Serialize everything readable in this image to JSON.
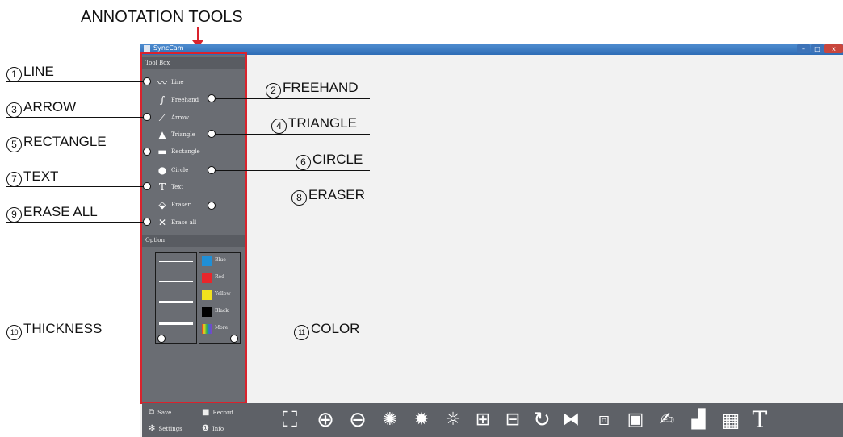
{
  "heading": "ANNOTATION TOOLS",
  "window": {
    "title": "SyncCam",
    "min": "–",
    "max": "□",
    "close": "x"
  },
  "toolbox": {
    "header": "Tool Box",
    "tools": {
      "line": "Line",
      "freehand": "Freehand",
      "arrow": "Arrow",
      "triangle": "Triangle",
      "rectangle": "Rectangle",
      "circle": "Circle",
      "text": "Text",
      "eraser": "Eraser",
      "erase_all": "Erase all"
    }
  },
  "option": {
    "header": "Option",
    "colors": [
      {
        "name": "Blue",
        "hex": "#1f8fd6"
      },
      {
        "name": "Red",
        "hex": "#e8262b"
      },
      {
        "name": "Yellow",
        "hex": "#f2e21e"
      },
      {
        "name": "Black",
        "hex": "#000000"
      },
      {
        "name": "More",
        "hex": "#3a6fd0"
      }
    ]
  },
  "bottom": {
    "save": "Save",
    "record": "Record",
    "settings": "Settings",
    "info": "Info"
  },
  "annotations": {
    "n1": "1",
    "l1": "LINE",
    "n2": "2",
    "l2": "FREEHAND",
    "n3": "3",
    "l3": "ARROW",
    "n4": "4",
    "l4": "TRIANGLE",
    "n5": "5",
    "l5": "RECTANGLE",
    "n6": "6",
    "l6": "CIRCLE",
    "n7": "7",
    "l7": "TEXT",
    "n8": "8",
    "l8": "ERASER",
    "n9": "9",
    "l9": "ERASE ALL",
    "n10": "10",
    "l10": "THICKNESS",
    "n11": "11",
    "l11": "COLOR"
  },
  "bottom_icons": [
    "user-frame-icon",
    "zoom-in-icon",
    "zoom-out-icon",
    "bulb-icon",
    "brightness-up-icon",
    "brightness-down-icon",
    "expand-icon",
    "shrink-icon",
    "rotate-icon",
    "flip-icon",
    "snapshot-icon",
    "image-compare-icon",
    "signature-icon",
    "bar-chart-icon",
    "grid-icon",
    "text-icon"
  ],
  "colors": {
    "highlight": "#d9232d",
    "panel": "#6a6d73"
  }
}
